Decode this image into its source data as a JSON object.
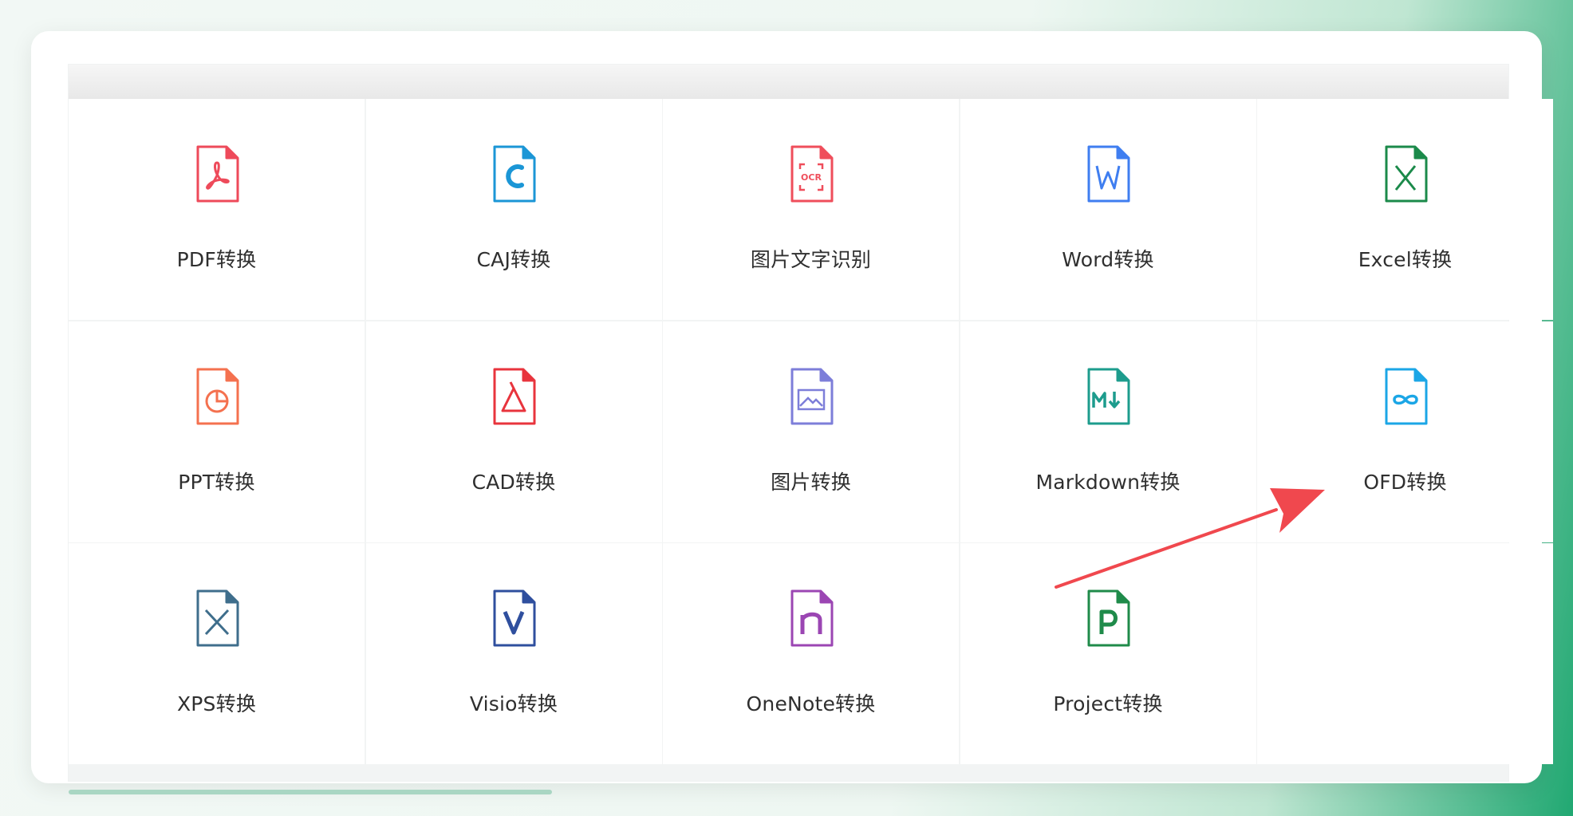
{
  "colors": {
    "accent": "#21a872",
    "arrow": "#f0484e"
  },
  "tools": [
    {
      "label": "PDF转换",
      "icon": "pdf-icon",
      "color": "#ee4a5a"
    },
    {
      "label": "CAJ转换",
      "icon": "caj-icon",
      "color": "#1b96d6"
    },
    {
      "label": "图片文字识别",
      "icon": "ocr-icon",
      "color": "#ef4e5b"
    },
    {
      "label": "Word转换",
      "icon": "word-icon",
      "color": "#3f7ef0"
    },
    {
      "label": "Excel转换",
      "icon": "excel-icon",
      "color": "#1b8a4a"
    },
    {
      "label": "PPT转换",
      "icon": "ppt-icon",
      "color": "#f4714f"
    },
    {
      "label": "CAD转换",
      "icon": "cad-icon",
      "color": "#e8343d"
    },
    {
      "label": "图片转换",
      "icon": "image-icon",
      "color": "#7d7ed9"
    },
    {
      "label": "Markdown转换",
      "icon": "markdown-icon",
      "color": "#1d9c8d"
    },
    {
      "label": "OFD转换",
      "icon": "ofd-icon",
      "color": "#1ba6e6"
    },
    {
      "label": "XPS转换",
      "icon": "xps-icon",
      "color": "#3f6e8c"
    },
    {
      "label": "Visio转换",
      "icon": "visio-icon",
      "color": "#2f4f9e"
    },
    {
      "label": "OneNote转换",
      "icon": "onenote-icon",
      "color": "#9b46b3"
    },
    {
      "label": "Project转换",
      "icon": "project-icon",
      "color": "#1f8b4a"
    }
  ]
}
